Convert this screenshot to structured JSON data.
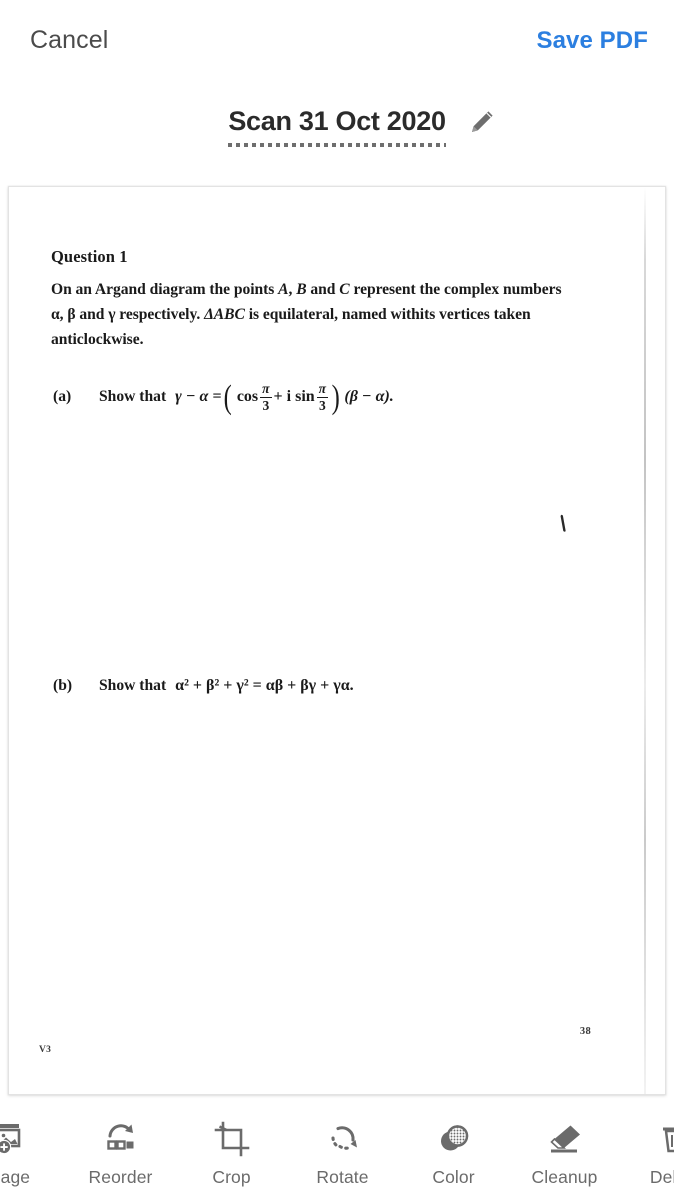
{
  "topbar": {
    "cancel_label": "Cancel",
    "save_label": "Save PDF",
    "accent_color": "#2c7fe0"
  },
  "title": {
    "text": "Scan 31 Oct 2020",
    "edit_icon": "pencil-icon"
  },
  "document": {
    "question_heading": "Question 1",
    "body_line_1_a": "On an Argand diagram the points ",
    "body_A": "A",
    "body_line_1_b": ", ",
    "body_B": "B",
    "body_line_1_c": " and ",
    "body_C": "C",
    "body_line_1_d": " represent the complex numbers",
    "body_line_2_a": "α, β and γ respectively. ",
    "body_ABC": "ΔABC",
    "body_line_2_b": " is equilateral, named withits vertices taken",
    "body_line_3": "anticlockwise.",
    "parts": [
      {
        "label": "(a)",
        "stem": "Show that",
        "math_lhs": "γ − α =",
        "math_cos": "cos",
        "math_num_1": "π",
        "math_den_1": "3",
        "math_plus_isin": "+ i sin",
        "math_num_2": "π",
        "math_den_2": "3",
        "math_rhs": "(β − α)."
      },
      {
        "label": "(b)",
        "stem": "Show that",
        "math": "α² + β² + γ² = αβ + βγ + γα."
      }
    ],
    "page_number": "38",
    "version_mark": "V3"
  },
  "toolbar": {
    "items": [
      {
        "label": "Page",
        "icon": "add-page-icon"
      },
      {
        "label": "Reorder",
        "icon": "reorder-icon"
      },
      {
        "label": "Crop",
        "icon": "crop-icon"
      },
      {
        "label": "Rotate",
        "icon": "rotate-icon"
      },
      {
        "label": "Color",
        "icon": "color-icon"
      },
      {
        "label": "Cleanup",
        "icon": "eraser-icon"
      },
      {
        "label": "Delete",
        "icon": "trash-icon"
      }
    ]
  }
}
